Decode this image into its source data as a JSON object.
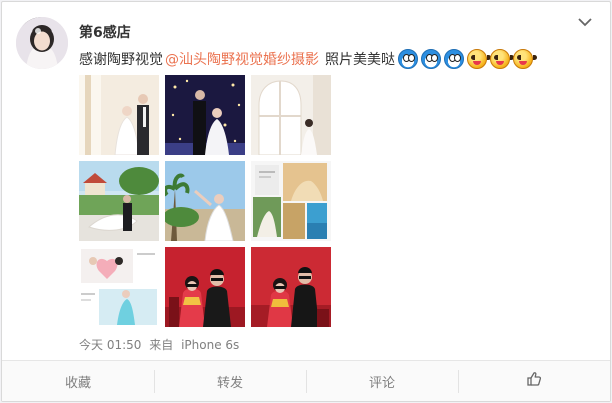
{
  "post": {
    "username": "第6感店",
    "content_text": "感谢陶野视觉",
    "mention": "@汕头陶野视觉婚纱摄影",
    "tail_text": "照片美美哒",
    "emojis": [
      "doraemon-icon",
      "doraemon-icon",
      "doraemon-icon",
      "happy-face-icon",
      "happy-face-icon",
      "happy-face-icon"
    ],
    "meta": {
      "time": "今天 01:50",
      "via": "来自",
      "source": "iPhone 6s"
    },
    "photo_count": 9
  },
  "actions": {
    "favorite_label": "收藏",
    "repost_label": "转发",
    "comment_label": "评论",
    "like_icon": "thumbs-up-icon"
  },
  "colors": {
    "link": "#eb7350",
    "meta": "#808080",
    "text": "#333333"
  }
}
